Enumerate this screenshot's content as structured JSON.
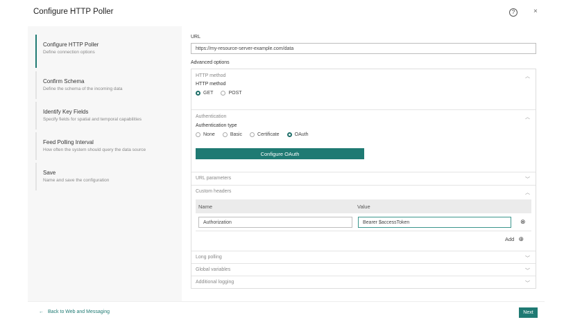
{
  "header": {
    "title": "Configure HTTP Poller",
    "help_icon": "?",
    "close_icon": "×"
  },
  "steps": [
    {
      "title": "Configure HTTP Poller",
      "desc": "Define connection options"
    },
    {
      "title": "Confirm Schema",
      "desc": "Define the schema of the incoming data"
    },
    {
      "title": "Identify Key Fields",
      "desc": "Specify fields for spatial and temporal capabilities"
    },
    {
      "title": "Feed Polling Interval",
      "desc": "How often the system should query the data source"
    },
    {
      "title": "Save",
      "desc": "Name and save the configuration"
    }
  ],
  "url": {
    "label": "URL",
    "value": "https://my-resource-server-example.com/data"
  },
  "advanced_label": "Advanced options",
  "http": {
    "header": "HTTP method",
    "label": "HTTP method",
    "options": [
      "GET",
      "POST"
    ],
    "selected": "GET"
  },
  "auth": {
    "header": "Authentication",
    "label": "Authentication type",
    "options": [
      "None",
      "Basic",
      "Certificate",
      "OAuth"
    ],
    "selected": "OAuth",
    "button": "Configure OAuth"
  },
  "url_params": "URL parameters",
  "headers": {
    "header": "Custom headers",
    "col_name": "Name",
    "col_value": "Value",
    "name": "Authorization",
    "value": "Bearer $accessToken",
    "add": "Add"
  },
  "collapsed": [
    "Long polling",
    "Global variables",
    "Additional logging"
  ],
  "footer": {
    "back": "Back to Web and Messaging",
    "next": "Next"
  },
  "colors": {
    "accent": "#1f7a73"
  }
}
